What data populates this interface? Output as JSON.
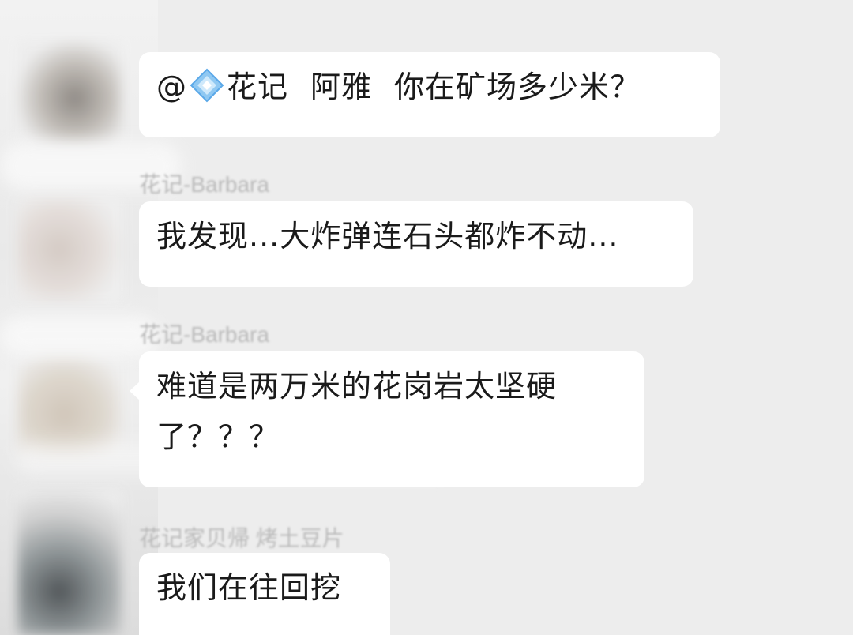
{
  "chat": {
    "messages": [
      {
        "sender": "",
        "mention_prefix": "@",
        "mention_icon": "diamond-badge-icon",
        "mention_name": "花记",
        "mention_target": "阿雅",
        "text": "你在矿场多少米？"
      },
      {
        "sender": "花记-Barbara",
        "text": "我发现...大炸弹连石头都炸不动..."
      },
      {
        "sender": "花记-Barbara",
        "text_line1": "难道是两万米的花岗岩太坚硬",
        "text_line2": "了？？？"
      },
      {
        "sender": "花记家贝帰  烤土豆片",
        "text": "我们在往回挖"
      }
    ]
  },
  "colors": {
    "background": "#ededed",
    "bubble": "#ffffff",
    "text": "#1a1a1a",
    "sender_name": "#b9b9b9",
    "mention_icon": "#5aa8e8"
  }
}
